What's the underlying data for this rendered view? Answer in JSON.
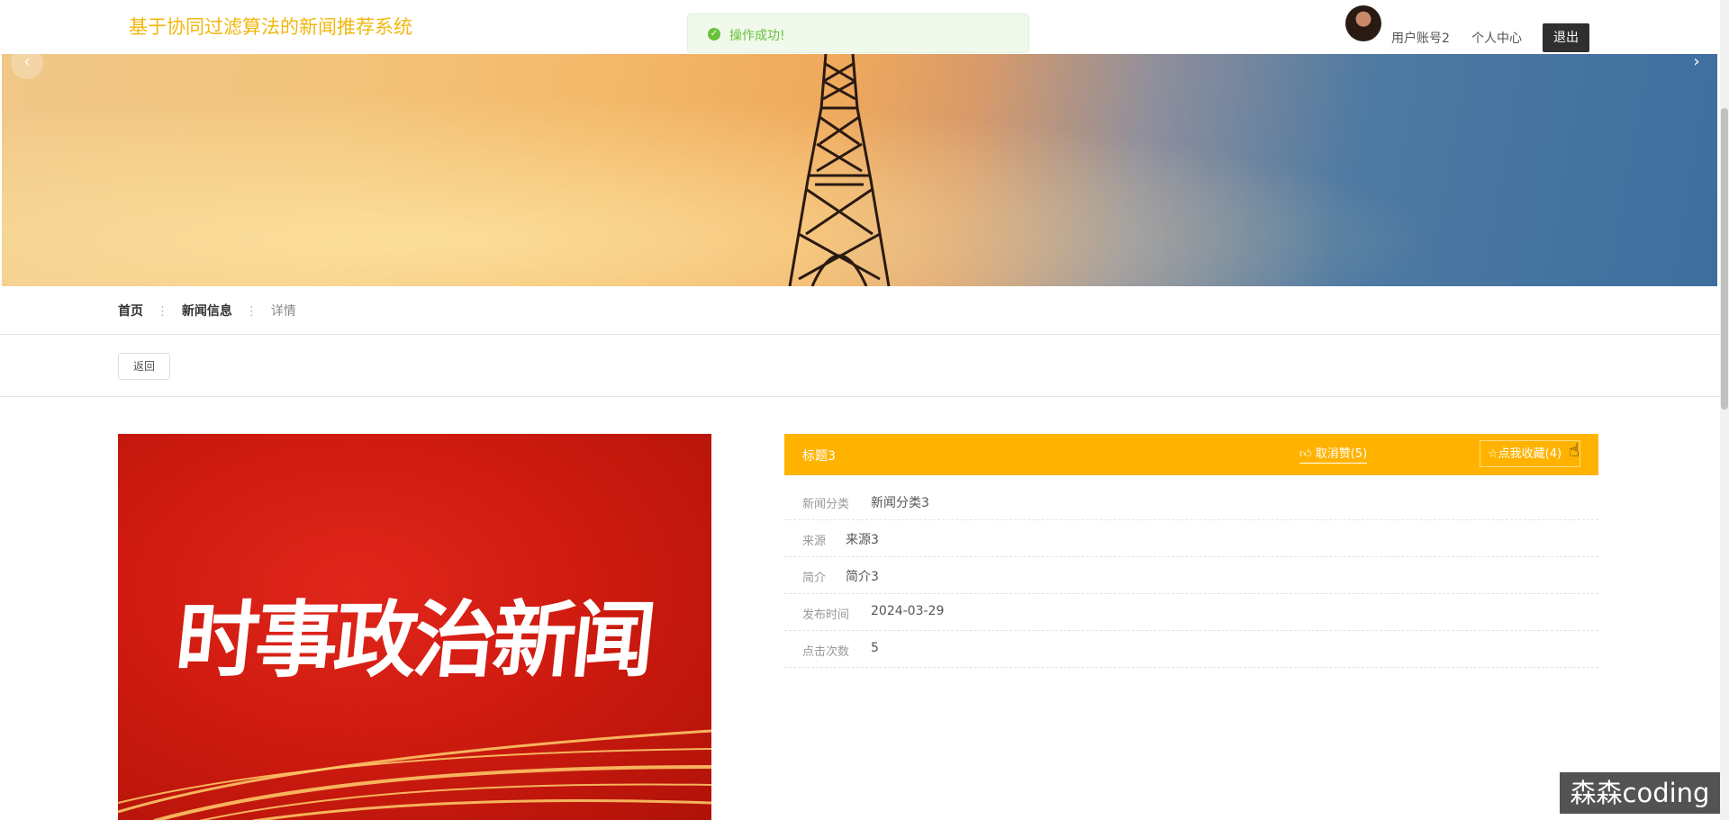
{
  "header": {
    "site_title": "基于协同过滤算法的新闻推荐系统",
    "user_account": "用户账号2",
    "profile_link": "个人中心",
    "logout": "退出"
  },
  "toast": {
    "message": "操作成功!",
    "icon": "check-circle-icon",
    "color": "#67c23a"
  },
  "banner": {
    "left_arrow": "‹",
    "right_arrow": "›",
    "slide_count": 3,
    "active_slide": 3
  },
  "breadcrumb": {
    "home": "首页",
    "section": "新闻信息",
    "separator": "⋮",
    "current": "详情"
  },
  "back_button": "返回",
  "news_image": {
    "text": "时事政治新闻"
  },
  "detail": {
    "title": "标题3",
    "unlike_label": "取消赞(5)",
    "favorite_label": "点我收藏(4)",
    "accent_color": "#ffb300",
    "fields": [
      {
        "label": "新闻分类",
        "value": "新闻分类3"
      },
      {
        "label": "来源",
        "value": "来源3"
      },
      {
        "label": "简介",
        "value": "简介3"
      },
      {
        "label": "发布时间",
        "value": "2024-03-29"
      },
      {
        "label": "点击次数",
        "value": "5"
      }
    ]
  },
  "watermark": "森森coding"
}
